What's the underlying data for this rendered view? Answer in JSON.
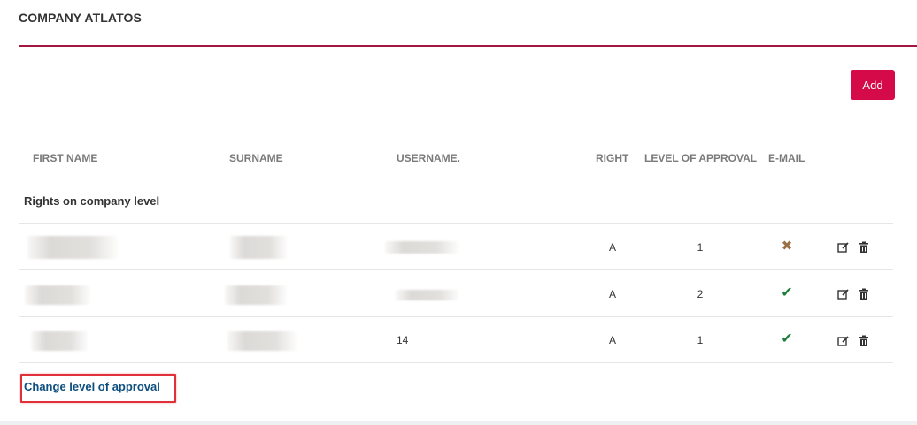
{
  "header": {
    "company_title": "COMPANY ATLATOS",
    "add_label": "Add"
  },
  "colors": {
    "accent": "#d50a48",
    "divider": "#a3163f",
    "link": "#0d4f80",
    "check": "#1f7d3a",
    "cross": "#9a7044",
    "highlight": "#e0303a"
  },
  "table": {
    "columns": {
      "first_name": "FIRST NAME",
      "surname": "SURNAME",
      "username": "USERNAME.",
      "right": "RIGHT",
      "level_of_approval": "LEVEL OF APPROVAL",
      "email": "E-MAIL"
    },
    "group_label": "Rights on company level",
    "rows": [
      {
        "first_name": "",
        "surname": "",
        "username": "",
        "right": "A",
        "level": "1",
        "email_icon": "cross-icon"
      },
      {
        "first_name": "",
        "surname": "",
        "username": "",
        "right": "A",
        "level": "2",
        "email_icon": "check-icon"
      },
      {
        "first_name": "",
        "surname": "",
        "username": "14",
        "right": "A",
        "level": "1",
        "email_icon": "check-icon"
      }
    ]
  },
  "footer": {
    "change_level_label": "Change level of approval"
  }
}
